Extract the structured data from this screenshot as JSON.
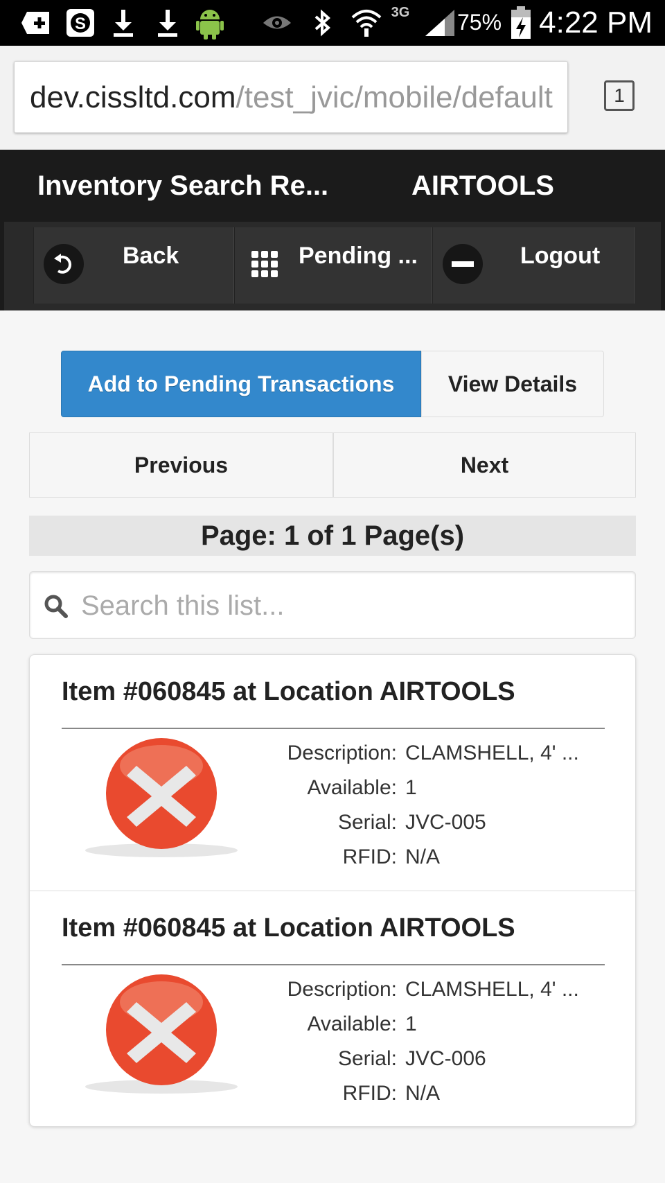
{
  "status_bar": {
    "network": "3G",
    "battery": "75%",
    "time": "4:22 PM",
    "icons": [
      "add-icon",
      "skype-icon",
      "download-icon",
      "download-icon",
      "android-icon",
      "eye-icon",
      "bluetooth-icon",
      "wifi-icon",
      "signal-icon",
      "battery-charging-icon"
    ]
  },
  "browser": {
    "url_host": "dev.cissltd.com",
    "url_path": "/test_jvic/mobile/default",
    "tab_count": "1"
  },
  "header": {
    "title": "Inventory Search Re...",
    "location": "AIRTOOLS"
  },
  "nav": {
    "back_label": "Back",
    "pending_label": "Pending ...",
    "logout_label": "Logout"
  },
  "actions": {
    "add_label": "Add to Pending Transactions",
    "details_label": "View Details",
    "accent_color": "#3388cc"
  },
  "pager": {
    "previous_label": "Previous",
    "next_label": "Next",
    "page_info": "Page: 1 of 1 Page(s)"
  },
  "search": {
    "placeholder": "Search this list..."
  },
  "items": [
    {
      "title": "Item #060845 at Location AIRTOOLS",
      "image": "red-x-icon",
      "description_label": "Description:",
      "description": "CLAMSHELL, 4' ...",
      "available_label": "Available:",
      "available": "1",
      "serial_label": "Serial:",
      "serial": "JVC-005",
      "rfid_label": "RFID:",
      "rfid": "N/A"
    },
    {
      "title": "Item #060845 at Location AIRTOOLS",
      "image": "red-x-icon",
      "description_label": "Description:",
      "description": "CLAMSHELL, 4' ...",
      "available_label": "Available:",
      "available": "1",
      "serial_label": "Serial:",
      "serial": "JVC-006",
      "rfid_label": "RFID:",
      "rfid": "N/A"
    }
  ]
}
